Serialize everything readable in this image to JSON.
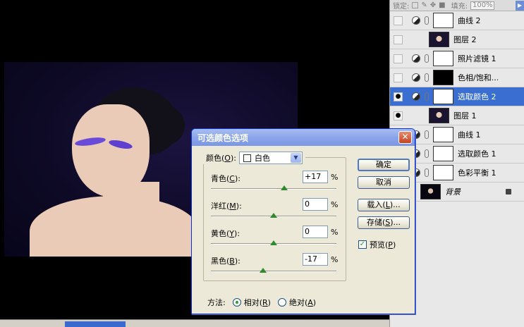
{
  "layers_panel": {
    "lock_label": "锁定:",
    "fill_label": "填充:",
    "fill_value": "100%",
    "layers": [
      {
        "name": "曲线 2",
        "type": "adjust",
        "visible": false,
        "mask": "white"
      },
      {
        "name": "图层 2",
        "type": "photo",
        "visible": false
      },
      {
        "name": "照片滤镜 1",
        "type": "adjust",
        "visible": false,
        "mask": "white"
      },
      {
        "name": "色相/饱和...",
        "type": "adjust",
        "visible": false,
        "mask": "black"
      },
      {
        "name": "选取颜色 2",
        "type": "adjust",
        "visible": true,
        "mask": "white",
        "selected": true
      },
      {
        "name": "图层 1",
        "type": "photo",
        "visible": true
      },
      {
        "name": "曲线 1",
        "type": "adjust",
        "visible": true,
        "mask": "white"
      },
      {
        "name": "选取颜色 1",
        "type": "adjust",
        "visible": true,
        "mask": "white"
      },
      {
        "name": "色彩平衡 1",
        "type": "adjust",
        "visible": true,
        "mask": "white"
      },
      {
        "name": "背景",
        "type": "background",
        "visible": true,
        "locked": true
      }
    ]
  },
  "dialog": {
    "title": "可选颜色选项",
    "color_label": "颜色(O):",
    "color_label_key": "O",
    "color_value": "白色",
    "sliders": [
      {
        "label": "青色",
        "key": "C",
        "value": "+17",
        "level": 17
      },
      {
        "label": "洋红",
        "key": "M",
        "value": "0",
        "level": 0
      },
      {
        "label": "黄色",
        "key": "Y",
        "value": "0",
        "level": 0
      },
      {
        "label": "黑色",
        "key": "B",
        "value": "-17",
        "level": -17
      }
    ],
    "percent": "%",
    "buttons": {
      "ok": "确定",
      "cancel": "取消",
      "load": "载入(L)...",
      "save": "存储(S)..."
    },
    "preview_label": "预览(P)",
    "preview_checked": true,
    "method_label": "方法:",
    "method_relative": "相对(R)",
    "method_absolute": "绝对(A)",
    "method_selected": "relative"
  }
}
